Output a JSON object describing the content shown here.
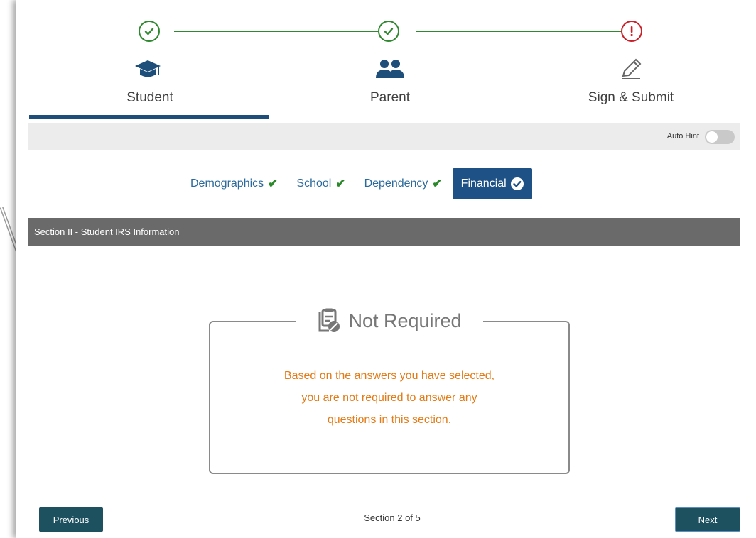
{
  "steps": [
    {
      "label": "Student",
      "status": "complete",
      "icon": "graduation-cap-icon"
    },
    {
      "label": "Parent",
      "status": "complete",
      "icon": "people-icon"
    },
    {
      "label": "Sign & Submit",
      "status": "incomplete",
      "icon": "pencil-icon"
    }
  ],
  "auto_hint": {
    "label": "Auto Hint",
    "enabled": false
  },
  "subtabs": [
    {
      "label": "Demographics",
      "complete": true
    },
    {
      "label": "School",
      "complete": true
    },
    {
      "label": "Dependency",
      "complete": true
    },
    {
      "label": "Financial",
      "complete": true,
      "active": true
    }
  ],
  "section": {
    "title": "Section II - Student IRS Information"
  },
  "not_required": {
    "title": "Not Required",
    "lines": [
      "Based on the answers you have selected,",
      "you are not required to answer any",
      "questions in this section."
    ]
  },
  "footer": {
    "previous_label": "Previous",
    "next_label": "Next",
    "page_indicator": "Section 2 of 5"
  },
  "colors": {
    "complete_green": "#2f8a2f",
    "warning_red": "#c9202a",
    "active_blue": "#1e5185",
    "notice_orange": "#e37b16",
    "button_teal": "#1d5160"
  }
}
